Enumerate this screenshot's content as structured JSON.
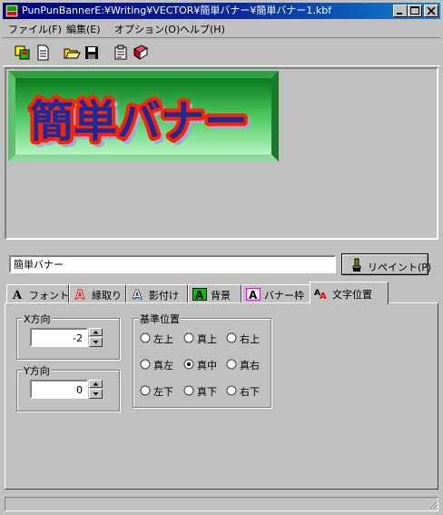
{
  "window": {
    "title": "PunPunBannerE:¥Writing¥VECTOR¥簡単バナー¥簡単バナー1.kbf"
  },
  "menu": {
    "items": [
      {
        "label": "ファイル(F)"
      },
      {
        "label": "編集(E)"
      },
      {
        "label": "オプション(O)"
      },
      {
        "label": "ヘルプ(H)"
      }
    ]
  },
  "toolbar": {
    "buttons": [
      "new-banner-icon",
      "new-document-icon",
      "open-folder-icon",
      "save-disk-icon",
      "properties-icon",
      "book-icon"
    ]
  },
  "preview": {
    "banner_text": "簡単バナー",
    "colors": {
      "bg_top": "#0a7a1a",
      "bg_bottom": "#a9f0b9",
      "text_fill": "#1a2c9c",
      "text_outline": "#ff2200",
      "text_shadow": "#a0a8d8"
    }
  },
  "editor": {
    "text_value": "簡単バナー",
    "repaint_label": "リペイント(P)"
  },
  "tabs": [
    {
      "label": "フォント",
      "icon": "font-a-icon",
      "active": false
    },
    {
      "label": "縁取り",
      "icon": "outline-a-icon",
      "active": false
    },
    {
      "label": "影付け",
      "icon": "shadow-a-icon",
      "active": false
    },
    {
      "label": "背景",
      "icon": "background-a-icon",
      "active": false
    },
    {
      "label": "バナー枠",
      "icon": "frame-a-icon",
      "active": false
    },
    {
      "label": "文字位置",
      "icon": "text-position-icon",
      "active": true
    }
  ],
  "position_panel": {
    "x_group": {
      "label": "X方向",
      "value": "-2"
    },
    "y_group": {
      "label": "Y方向",
      "value": "0"
    },
    "anchor_group": {
      "label": "基準位置",
      "options": [
        {
          "label": "左上",
          "checked": false
        },
        {
          "label": "真上",
          "checked": false
        },
        {
          "label": "右上",
          "checked": false
        },
        {
          "label": "真左",
          "checked": false
        },
        {
          "label": "真中",
          "checked": true
        },
        {
          "label": "真右",
          "checked": false
        },
        {
          "label": "左下",
          "checked": false
        },
        {
          "label": "真下",
          "checked": false
        },
        {
          "label": "右下",
          "checked": false
        }
      ]
    }
  }
}
